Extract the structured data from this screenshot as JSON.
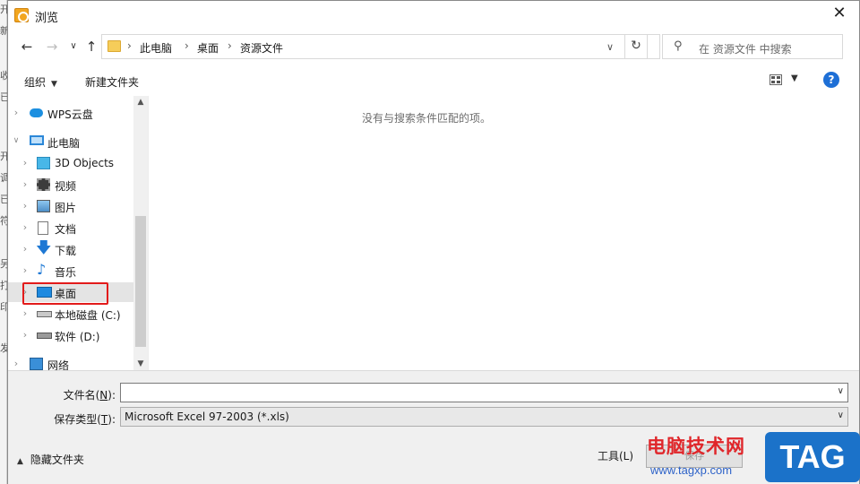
{
  "background_edge": [
    "开",
    "新",
    "收",
    "已",
    "开",
    "调",
    "已",
    "符",
    "另",
    "打",
    "印",
    "发"
  ],
  "window": {
    "title": "浏览",
    "close": "✕"
  },
  "address": {
    "crumbs": [
      "此电脑",
      "桌面",
      "资源文件"
    ],
    "separator": "›",
    "dropdown": "∨"
  },
  "nav": {
    "back": "←",
    "forward": "→",
    "recent": "∨",
    "up": "↑",
    "refresh": "↻"
  },
  "search": {
    "placeholder": "在 资源文件 中搜索"
  },
  "toolbar": {
    "organize": "组织",
    "new_folder": "新建文件夹",
    "help": "?"
  },
  "tree": {
    "items": [
      {
        "label": "WPS云盘",
        "icon": "cloud-icon"
      },
      {
        "label": "此电脑",
        "icon": "computer-icon"
      },
      {
        "label": "3D Objects",
        "icon": "cube-icon"
      },
      {
        "label": "视频",
        "icon": "video-icon"
      },
      {
        "label": "图片",
        "icon": "picture-icon"
      },
      {
        "label": "文档",
        "icon": "document-icon"
      },
      {
        "label": "下载",
        "icon": "download-icon"
      },
      {
        "label": "音乐",
        "icon": "music-icon"
      },
      {
        "label": "桌面",
        "icon": "desktop-icon",
        "selected": true
      },
      {
        "label": "本地磁盘 (C:)",
        "icon": "drive-c-icon"
      },
      {
        "label": "软件 (D:)",
        "icon": "drive-d-icon"
      },
      {
        "label": "网络",
        "icon": "network-icon"
      }
    ]
  },
  "content": {
    "empty_message": "没有与搜索条件匹配的项。"
  },
  "form": {
    "filename_label": "文件名(",
    "filename_key": "N",
    "filename_tail": "):",
    "filename_value": "",
    "filetype_label": "保存类型(",
    "filetype_key": "T",
    "filetype_tail": "):",
    "filetype_value": "Microsoft Excel 97-2003 (*.xls)"
  },
  "footer": {
    "hide_folders": "隐藏文件夹",
    "tools": "工具(L)",
    "save_partial": "保存"
  },
  "watermark": {
    "title": "电脑技术网",
    "url": "www.tagxp.com",
    "tag": "TAG"
  },
  "colors": {
    "selection_box": "#e21b1b",
    "help": "#1e6fd6",
    "watermark_red": "#e0262a",
    "watermark_blue": "#1b72c9"
  }
}
